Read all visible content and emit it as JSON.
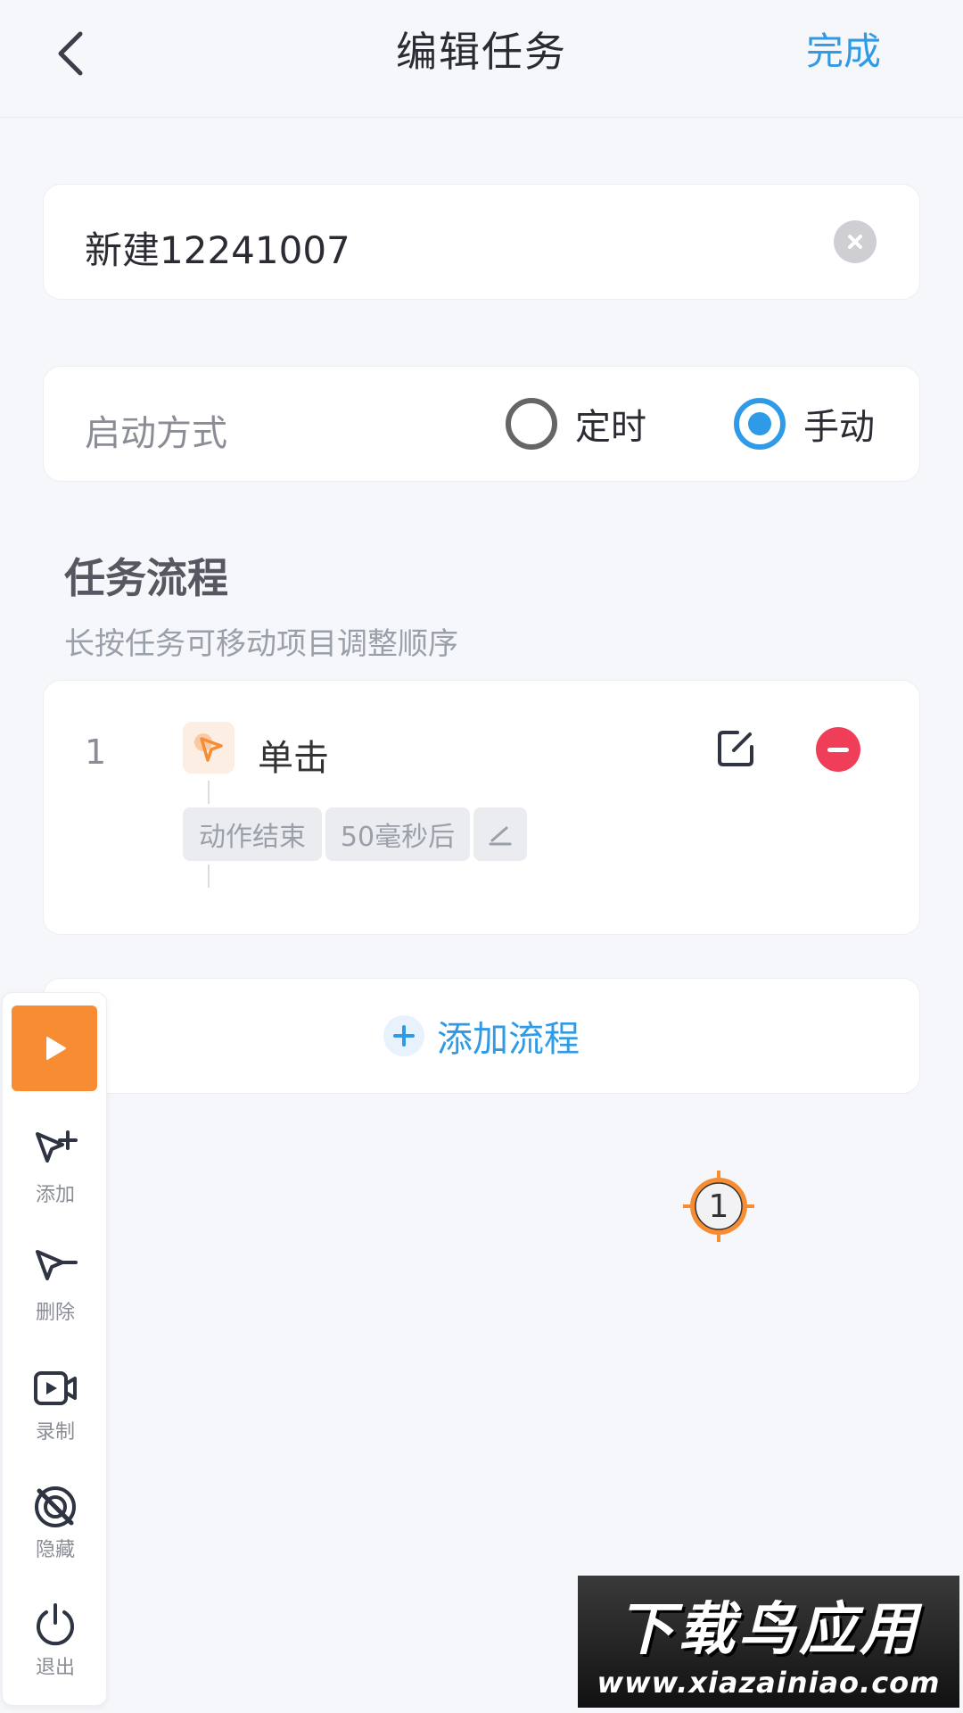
{
  "header": {
    "title": "编辑任务",
    "done_label": "完成"
  },
  "task_name": {
    "value": "新建12241007"
  },
  "start_mode": {
    "label": "启动方式",
    "options": [
      {
        "label": "定时",
        "selected": false
      },
      {
        "label": "手动",
        "selected": true
      }
    ]
  },
  "flow_section": {
    "title": "任务流程",
    "subtitle": "长按任务可移动项目调整顺序"
  },
  "flow_items": [
    {
      "index": "1",
      "action": "单击",
      "tags": [
        "动作结束",
        "50毫秒后"
      ]
    }
  ],
  "add_flow_label": "添加流程",
  "toolbar": {
    "items": [
      {
        "label": "添加",
        "icon": "cursor-plus-icon"
      },
      {
        "label": "删除",
        "icon": "cursor-minus-icon"
      },
      {
        "label": "录制",
        "icon": "record-icon"
      },
      {
        "label": "隐藏",
        "icon": "hide-icon"
      },
      {
        "label": "退出",
        "icon": "power-icon"
      }
    ]
  },
  "tap_marker": {
    "number": "1"
  },
  "watermark": {
    "title": "下载鸟应用",
    "url": "www.xiazainiao.com"
  },
  "colors": {
    "accent": "#2f9be6",
    "danger": "#f03d58",
    "orange": "#f78c32"
  }
}
